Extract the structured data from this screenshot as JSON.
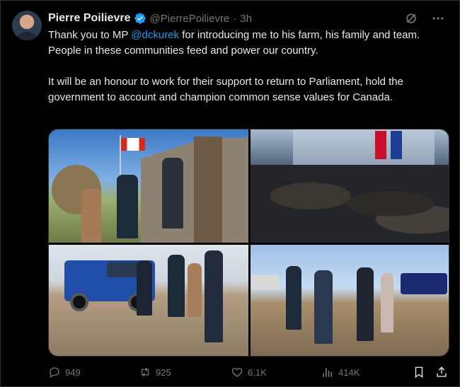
{
  "author": {
    "name": "Pierre Poilievre",
    "handle": "@PierrePoilievre",
    "separator": "·",
    "time": "3h"
  },
  "tweet": {
    "line1_before": "Thank you to MP ",
    "mention": "@dckurek",
    "line1_after": " for introducing me to his farm, his family and team. People in these communities feed and power our country.",
    "paragraph2": "It will be an honour to work for their support to return to Parliament, hold the government to account and champion common sense values for Canada."
  },
  "metrics": {
    "replies": "949",
    "reposts": "925",
    "likes": "6.1K",
    "views": "414K"
  },
  "colors": {
    "accent": "#1d9bf0",
    "muted": "#71767b",
    "text": "#e7e9ea",
    "background": "#000000"
  },
  "icons": [
    "verified-badge-icon",
    "grok-icon",
    "more-icon",
    "reply-icon",
    "retweet-icon",
    "like-icon",
    "views-icon",
    "bookmark-icon",
    "share-icon"
  ]
}
